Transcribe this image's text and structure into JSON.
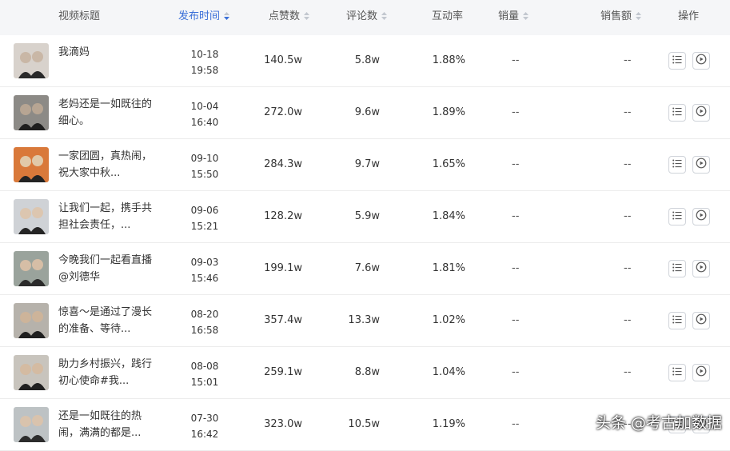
{
  "header": {
    "title": "视频标题",
    "publish_time": "发布时间",
    "likes": "点赞数",
    "comments": "评论数",
    "engagement": "互动率",
    "sales": "销量",
    "revenue": "销售额",
    "actions": "操作"
  },
  "rows": [
    {
      "title": "我滴妈",
      "date": "10-18",
      "time": "19:58",
      "likes": "140.5w",
      "comments": "5.8w",
      "rate": "1.88%",
      "sales": "--",
      "revenue": "--"
    },
    {
      "title": "老妈还是一如既往的细心。",
      "date": "10-04",
      "time": "16:40",
      "likes": "272.0w",
      "comments": "9.6w",
      "rate": "1.89%",
      "sales": "--",
      "revenue": "--"
    },
    {
      "title": "一家团圆，真热闹，祝大家中秋...",
      "date": "09-10",
      "time": "15:50",
      "likes": "284.3w",
      "comments": "9.7w",
      "rate": "1.65%",
      "sales": "--",
      "revenue": "--"
    },
    {
      "title": "让我们一起，携手共担社会责任，...",
      "date": "09-06",
      "time": "15:21",
      "likes": "128.2w",
      "comments": "5.9w",
      "rate": "1.84%",
      "sales": "--",
      "revenue": "--"
    },
    {
      "title": "今晚我们一起看直播@刘德华",
      "date": "09-03",
      "time": "15:46",
      "likes": "199.1w",
      "comments": "7.6w",
      "rate": "1.81%",
      "sales": "--",
      "revenue": "--"
    },
    {
      "title": "惊喜～是通过了漫长的准备、等待...",
      "date": "08-20",
      "time": "16:58",
      "likes": "357.4w",
      "comments": "13.3w",
      "rate": "1.02%",
      "sales": "--",
      "revenue": "--"
    },
    {
      "title": "助力乡村振兴，践行初心使命#我...",
      "date": "08-08",
      "time": "15:01",
      "likes": "259.1w",
      "comments": "8.8w",
      "rate": "1.04%",
      "sales": "--",
      "revenue": "--"
    },
    {
      "title": "还是一如既往的热闹，满满的都是...",
      "date": "07-30",
      "time": "16:42",
      "likes": "323.0w",
      "comments": "10.5w",
      "rate": "1.19%",
      "sales": "--",
      "revenue": "--"
    }
  ],
  "watermark": "头条 @考古加数据",
  "colors": {
    "accent": "#3a6fd8",
    "header_bg": "#f5f6f8",
    "border": "#ececec"
  },
  "icons": {
    "detail": "list-icon",
    "play": "play-circle-icon",
    "sort": "sort-arrows-icon"
  }
}
